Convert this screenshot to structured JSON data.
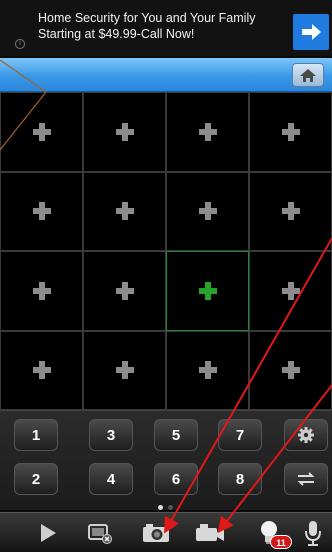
{
  "ad": {
    "line1": "Home Security for You and Your Family",
    "line2": "Starting at $49.99-Call Now!",
    "info_glyph": "i",
    "arrow_icon": "arrow-right-icon",
    "accent": "#1f7be0"
  },
  "header": {
    "home_icon": "home-icon",
    "bar_color": "#3a98e8"
  },
  "grid": {
    "rows": 4,
    "cols": 4,
    "active_cell": {
      "row": 3,
      "col": 3
    },
    "cell_icon": "plus-icon",
    "active_color": "#28a32c"
  },
  "keypad": {
    "row1": [
      "1",
      "3",
      "5",
      "7"
    ],
    "row2": [
      "2",
      "4",
      "6",
      "8"
    ],
    "settings_icon": "gear-icon",
    "swap_icon": "swap-arrows-icon",
    "page_count": 2,
    "current_page": 1
  },
  "toolbar": {
    "tools": [
      {
        "name": "play-icon"
      },
      {
        "name": "close-all-icon"
      },
      {
        "name": "snapshot-icon"
      },
      {
        "name": "record-icon"
      },
      {
        "name": "alarm-light-icon",
        "badge": "11"
      },
      {
        "name": "microphone-icon"
      }
    ]
  },
  "annotation": {
    "arrow_color": "#e01818",
    "callout_color": "#a0602a"
  }
}
